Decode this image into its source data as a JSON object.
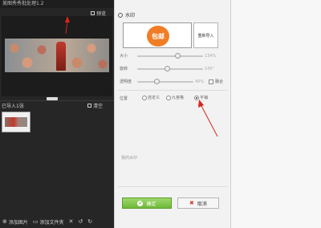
{
  "app": {
    "title": "美图秀秀批处理1.2"
  },
  "left": {
    "preview_label": "预览",
    "imported_label": "已导入1张",
    "clear_label": "清空",
    "toolbar": {
      "add_image": "添加图片",
      "add_folder": "添加文件夹"
    }
  },
  "panel": {
    "header": "水印",
    "watermark_text": "包邮",
    "reimport": "重新导入",
    "sliders": {
      "size": {
        "label": "大小",
        "value": "134%",
        "level": 0.62
      },
      "rotate": {
        "label": "旋转",
        "value": "145°",
        "level": 0.46
      },
      "opacity": {
        "label": "透明度",
        "value": "40%",
        "level": 0.35
      }
    },
    "blend": "融合",
    "position": {
      "label": "位置",
      "options": [
        "自定义",
        "九宫格",
        "平铺"
      ],
      "selected": "平铺"
    },
    "description": "我的水印",
    "ok": "确定",
    "cancel": "取消"
  },
  "colors": {
    "accent_green": "#6fb93a",
    "badge_orange": "#f07d25",
    "annotation_red": "#d9261c"
  }
}
